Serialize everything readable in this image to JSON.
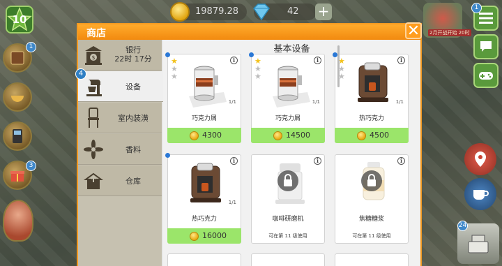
{
  "hud": {
    "level": "10",
    "coins": "19879.28",
    "gems": "42",
    "gem_plus": "+",
    "event_label": "2月开战开始 20时"
  },
  "side_badges": {
    "right_top": "1",
    "left_book": "1",
    "left_gift": "3",
    "right_register": "24"
  },
  "shop": {
    "title": "商店",
    "close": "✕",
    "section_title": "基本设备",
    "categories": [
      {
        "label": "银行",
        "sublabel": "22时 17分",
        "icon": "bank-icon"
      },
      {
        "label": "设备",
        "badge": "4",
        "icon": "stand-mixer-icon",
        "active": true
      },
      {
        "label": "室内装潢",
        "icon": "chair-icon"
      },
      {
        "label": "香料",
        "icon": "spice-icon"
      },
      {
        "label": "仓库",
        "icon": "warehouse-icon"
      }
    ],
    "items": [
      {
        "name": "巧克力屑",
        "count": "1/1",
        "price": "4300",
        "stars": 1,
        "locked": false,
        "new": true
      },
      {
        "name": "巧克力屑",
        "count": "1/1",
        "price": "14500",
        "stars": 1,
        "locked": false,
        "new": true
      },
      {
        "name": "热巧克力",
        "count": "1/1",
        "price": "4500",
        "stars": 1,
        "locked": false,
        "new": true
      },
      {
        "name": "热巧克力",
        "count": "1/1",
        "price": "16000",
        "stars": 0,
        "locked": false,
        "new": true
      },
      {
        "name": "咖啡研磨机",
        "requirement": "可在第 11 级使用",
        "locked": true
      },
      {
        "name": "焦糖糖浆",
        "requirement": "可在第 11 级使用",
        "locked": true
      }
    ]
  },
  "colors": {
    "header_orange": "#f28a0f",
    "price_green": "#9be56a",
    "new_dot_blue": "#2a78d6",
    "star_gold": "#f3c21b"
  }
}
